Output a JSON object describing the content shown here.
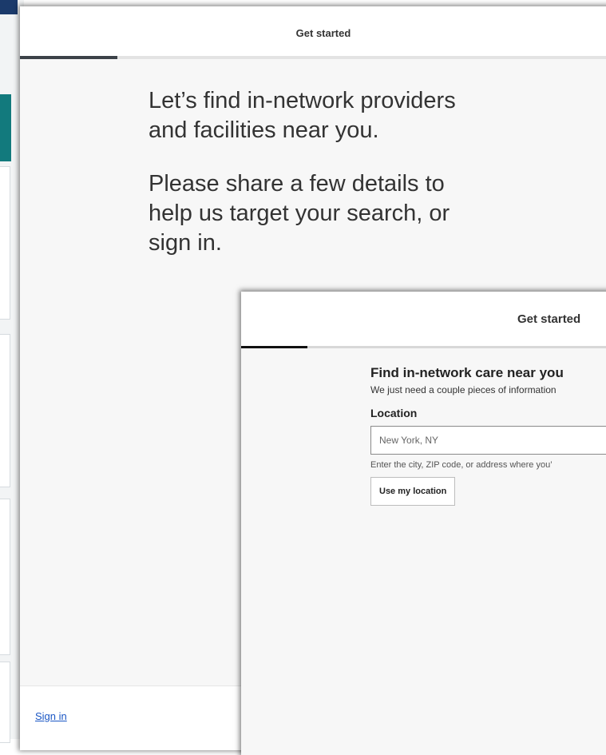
{
  "back_modal": {
    "header_title": "Get started",
    "intro_line": "Let’s find in-network providers and facilities near you.",
    "details_line": "Please share a few details to help us target your search, or sign in.",
    "footer_link": "Sign in",
    "progress_fraction": 0.16
  },
  "front_modal": {
    "header_title": "Get started",
    "title": "Find in-network care near you",
    "subtitle": "We just need a couple pieces of information",
    "location_label": "Location",
    "location_placeholder": "New York, NY",
    "location_hint": "Enter the city, ZIP code, or address where you’",
    "use_location_button": "Use my location",
    "progress_fraction": 0.18
  },
  "colors": {
    "brand_navy": "#1b3a6b",
    "brand_teal": "#127a7d",
    "link_blue": "#1a56c4",
    "progress_dark": "#3c4248"
  }
}
